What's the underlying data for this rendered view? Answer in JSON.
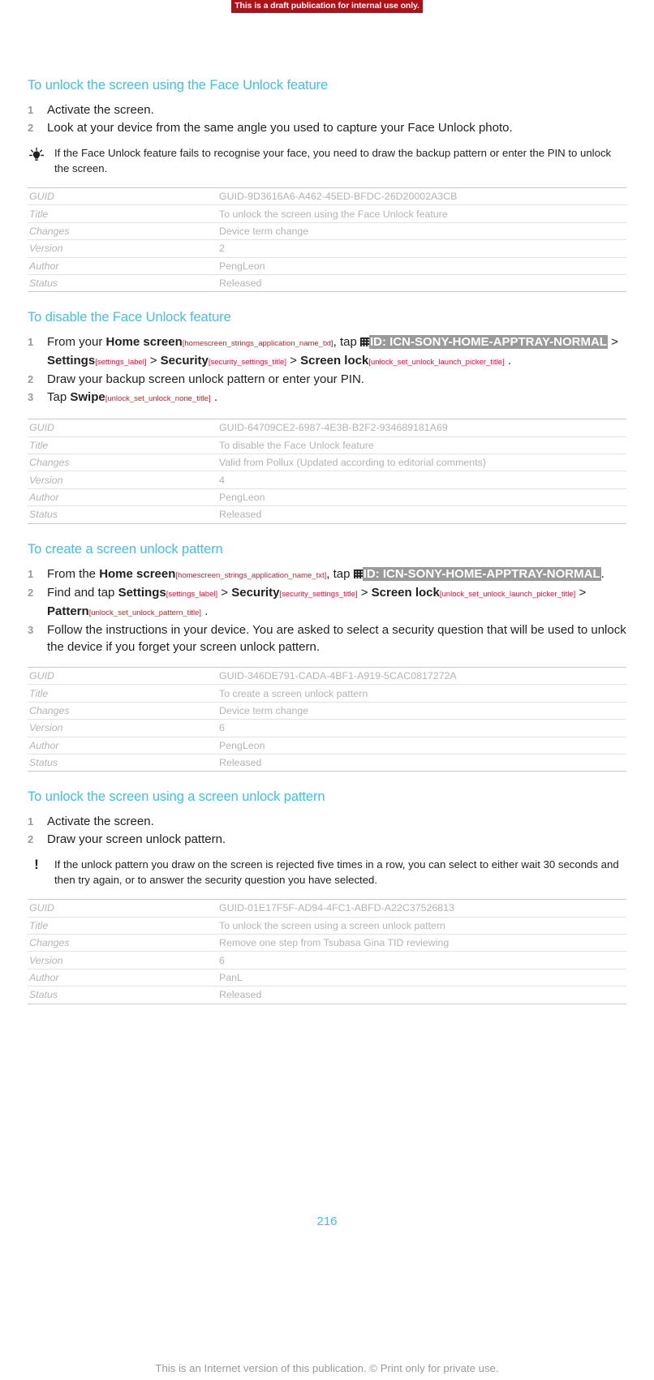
{
  "banner": {
    "text": "This is a draft publication for internal use only.",
    "color": "#b01116"
  },
  "accent_color": "#3ec1e8",
  "string_id_color": "#e8112d",
  "sections": [
    {
      "title": "To unlock the screen using the Face Unlock feature",
      "steps": [
        {
          "num": "1",
          "text": "Activate the screen."
        },
        {
          "num": "2",
          "text": "Look at your device from the same angle you used to capture your Face Unlock photo."
        }
      ],
      "note": {
        "icon": "lightbulb-icon",
        "text": "If the Face Unlock feature fails to recognise your face, you need to draw the backup pattern or enter the PIN to unlock the screen."
      },
      "meta": {
        "labels": [
          "GUID",
          "Title",
          "Changes",
          "Version",
          "Author",
          "Status"
        ],
        "values": [
          "GUID-9D3616A6-A462-45ED-BFDC-26D20002A3CB",
          "To unlock the screen using the Face Unlock feature",
          "Device term change",
          "2",
          "PengLeon",
          "Released"
        ]
      }
    },
    {
      "title": "To disable the Face Unlock feature",
      "step1": {
        "num": "1",
        "lead": "From your ",
        "ui_home": "Home screen",
        "sid_home": "[homescreen_strings_application_name_txt]",
        "tap": ", tap ",
        "icon": "apptray-grid-icon",
        "hl_icon_text": "ID: ICN-SONY-HOME-APPTRAY-NORMAL",
        "sep1": " > ",
        "ui_settings": "Settings",
        "sid_settings": "[settings_label]",
        "sep2": " > ",
        "ui_security": "Security",
        "sid_security": "[security_settings_title]",
        "sep3": " > ",
        "ui_screenlock": "Screen lock",
        "sid_screenlock": "[unlock_set_unlock_launch_picker_title]",
        "period": " ."
      },
      "steps_rest": [
        {
          "num": "2",
          "text": "Draw your backup screen unlock pattern or enter your PIN."
        }
      ],
      "step3": {
        "num": "3",
        "lead": "Tap ",
        "ui": "Swipe",
        "sid": "[unlock_set_unlock_none_title]",
        "period": " ."
      },
      "meta": {
        "labels": [
          "GUID",
          "Title",
          "Changes",
          "Version",
          "Author",
          "Status"
        ],
        "values": [
          "GUID-64709CE2-6987-4E3B-B2F2-934689181A69",
          "To disable the Face Unlock feature",
          "Valid from Pollux (Updated according to editorial comments)",
          "4",
          "PengLeon",
          "Released"
        ]
      }
    },
    {
      "title": "To create a screen unlock pattern",
      "step1": {
        "num": "1",
        "lead": "From the ",
        "ui_home": "Home screen",
        "sid_home": "[homescreen_strings_application_name_txt]",
        "tap": ", tap ",
        "icon": "apptray-grid-icon",
        "hl_icon_text": "ID: ICN-SONY-HOME-APPTRAY-NORMAL",
        "period": "."
      },
      "step2": {
        "num": "2",
        "lead": "Find and tap ",
        "ui_settings": "Settings",
        "sid_settings": "[settings_label]",
        "sep1": " > ",
        "ui_security": "Security",
        "sid_security": "[security_settings_title]",
        "sep2": " > ",
        "ui_screenlock": "Screen lock",
        "sid_screenlock": "[unlock_set_unlock_launch_picker_title]",
        "sep3": " > ",
        "ui_pattern": "Pattern",
        "sid_pattern": "[unlock_set_unlock_pattern_title]",
        "period": " ."
      },
      "step3": {
        "num": "3",
        "text": "Follow the instructions in your device. You are asked to select a security question that will be used to unlock the device if you forget your screen unlock pattern."
      },
      "meta": {
        "labels": [
          "GUID",
          "Title",
          "Changes",
          "Version",
          "Author",
          "Status"
        ],
        "values": [
          "GUID-346DE791-CADA-4BF1-A919-5CAC0817272A",
          "To create a screen unlock pattern",
          "Device term change",
          "6",
          "PengLeon",
          "Released"
        ]
      }
    },
    {
      "title": "To unlock the screen using a screen unlock pattern",
      "steps": [
        {
          "num": "1",
          "text": "Activate the screen."
        },
        {
          "num": "2",
          "text": "Draw your screen unlock pattern."
        }
      ],
      "note": {
        "icon": "exclamation-icon",
        "text": "If the unlock pattern you draw on the screen is rejected five times in a row, you can select to either wait 30 seconds and then try again, or to answer the security question you have selected."
      },
      "meta": {
        "labels": [
          "GUID",
          "Title",
          "Changes",
          "Version",
          "Author",
          "Status"
        ],
        "values": [
          "GUID-01E17F5F-AD94-4FC1-ABFD-A22C37526813",
          "To unlock the screen using a screen unlock pattern",
          "Remove one step from Tsubasa Gina TID reviewing",
          "6",
          "PanL",
          "Released"
        ]
      }
    }
  ],
  "footer": {
    "page_number": "216",
    "note": "This is an Internet version of this publication. © Print only for private use."
  }
}
